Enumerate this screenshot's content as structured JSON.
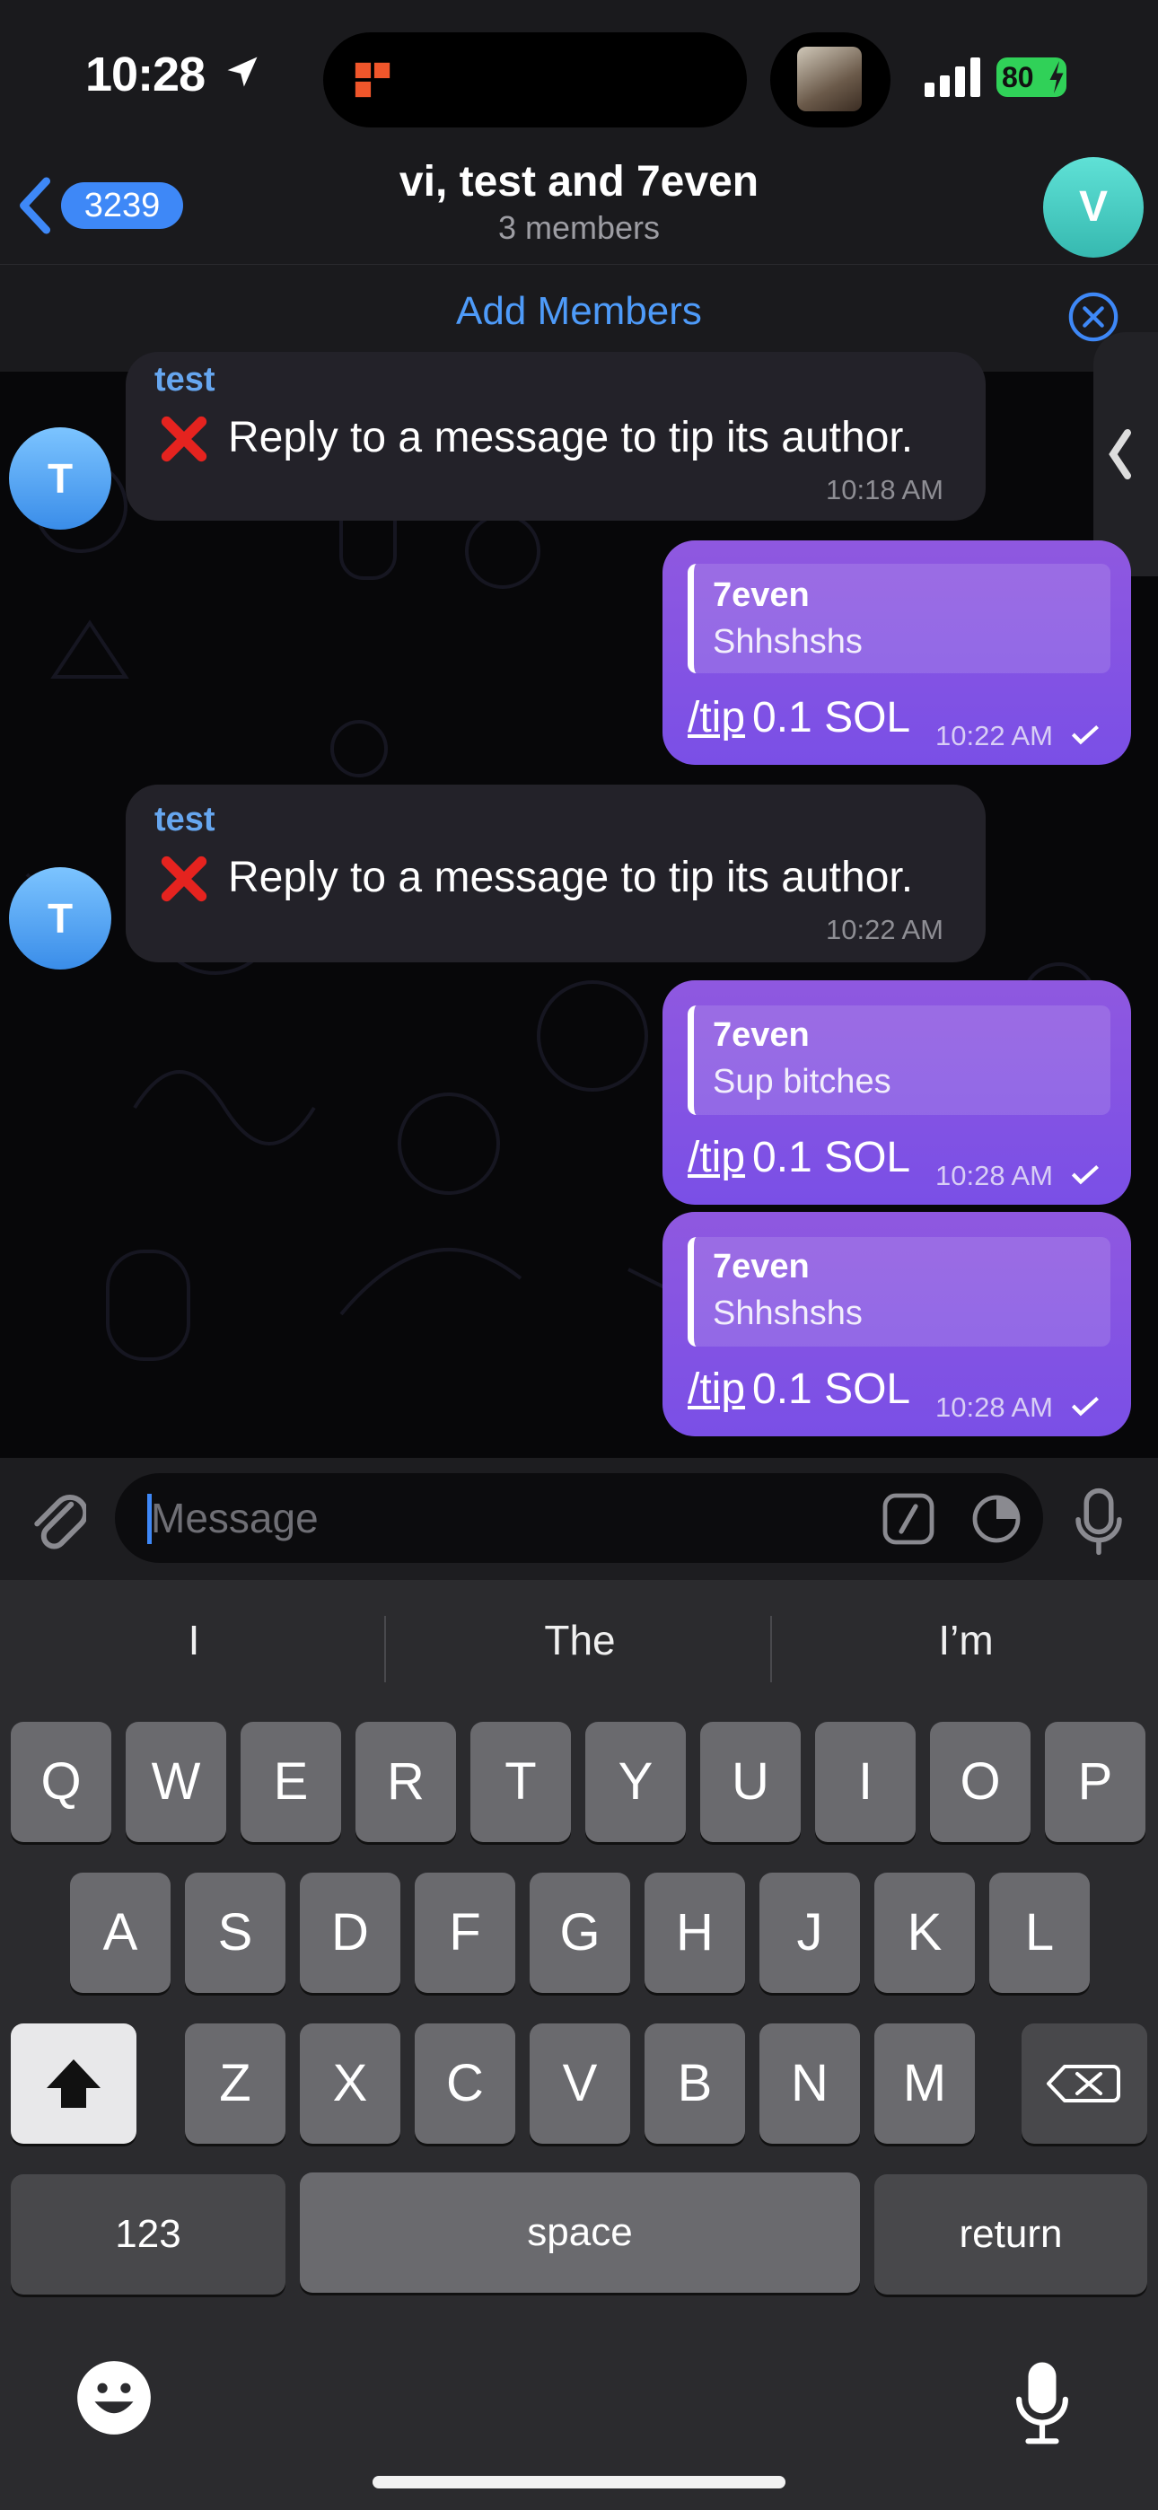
{
  "status": {
    "time": "10:28",
    "battery": "80"
  },
  "header": {
    "back_count": "3239",
    "title": "vi, test and 7even",
    "subtitle": "3 members",
    "avatar_letter": "V"
  },
  "add_members": {
    "label": "Add Members"
  },
  "messages": [
    {
      "sender": "test",
      "text": "Reply to a message to tip its author.",
      "time": "10:18 AM",
      "avatar": "T"
    },
    {
      "reply_name": "7even",
      "reply_text": "Shhshshs",
      "command": "/tip",
      "text": " 0.1 SOL",
      "time": "10:22 AM"
    },
    {
      "sender": "test",
      "text": "Reply to a message to tip its author.",
      "time": "10:22 AM",
      "avatar": "T"
    },
    {
      "reply_name": "7even",
      "reply_text": "Sup bitches",
      "command": "/tip",
      "text": " 0.1 SOL",
      "time": "10:28 AM"
    },
    {
      "reply_name": "7even",
      "reply_text": "Shhshshs",
      "command": "/tip",
      "text": " 0.1 SOL",
      "time": "10:28 AM"
    }
  ],
  "composer": {
    "placeholder": "Message"
  },
  "keyboard": {
    "suggestions": [
      "I",
      "The",
      "I’m"
    ],
    "row1": [
      "Q",
      "W",
      "E",
      "R",
      "T",
      "Y",
      "U",
      "I",
      "O",
      "P"
    ],
    "row2": [
      "A",
      "S",
      "D",
      "F",
      "G",
      "H",
      "J",
      "K",
      "L"
    ],
    "row3": [
      "Z",
      "X",
      "C",
      "V",
      "B",
      "N",
      "M"
    ],
    "numbers": "123",
    "space": "space",
    "return": "return"
  },
  "colors": {
    "accent": "#3e88f7",
    "outgoing": "#8452e4",
    "incoming": "#232229",
    "sender": "#66a6ef"
  }
}
